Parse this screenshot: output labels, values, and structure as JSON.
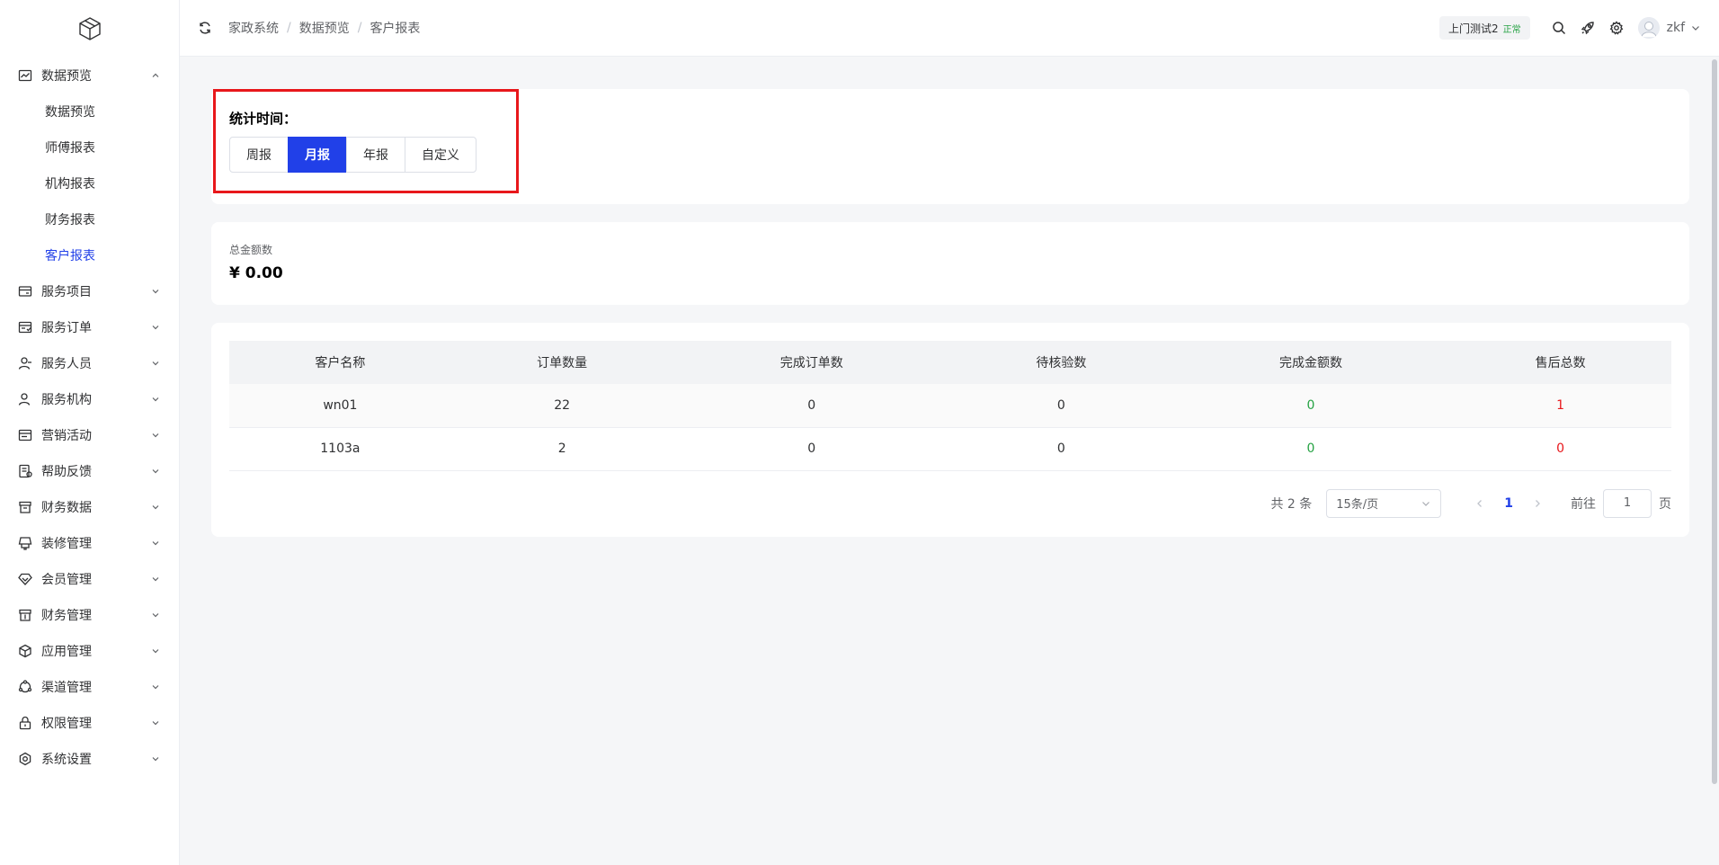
{
  "sidebar": {
    "menu": [
      {
        "label": "数据预览",
        "icon": "chart-line-icon",
        "expanded": true
      },
      {
        "label": "服务项目",
        "icon": "card-icon"
      },
      {
        "label": "服务订单",
        "icon": "order-icon"
      },
      {
        "label": "服务人员",
        "icon": "user-icon"
      },
      {
        "label": "服务机构",
        "icon": "org-user-icon"
      },
      {
        "label": "营销活动",
        "icon": "marketing-icon"
      },
      {
        "label": "帮助反馈",
        "icon": "feedback-icon"
      },
      {
        "label": "财务数据",
        "icon": "finance-data-icon"
      },
      {
        "label": "装修管理",
        "icon": "decoration-icon"
      },
      {
        "label": "会员管理",
        "icon": "member-diamond-icon"
      },
      {
        "label": "财务管理",
        "icon": "finance-manage-icon"
      },
      {
        "label": "应用管理",
        "icon": "app-cube-icon"
      },
      {
        "label": "渠道管理",
        "icon": "channel-icon"
      },
      {
        "label": "权限管理",
        "icon": "lock-icon"
      },
      {
        "label": "系统设置",
        "icon": "settings-icon"
      }
    ],
    "submenu": [
      {
        "label": "数据预览"
      },
      {
        "label": "师傅报表"
      },
      {
        "label": "机构报表"
      },
      {
        "label": "财务报表"
      },
      {
        "label": "客户报表",
        "active": true
      }
    ]
  },
  "header": {
    "breadcrumb": [
      "家政系统",
      "数据预览",
      "客户报表"
    ],
    "store_name": "上门测试2",
    "store_status": "正常",
    "username": "zkf"
  },
  "filter": {
    "title": "统计时间：",
    "options": [
      "周报",
      "月报",
      "年报",
      "自定义"
    ],
    "selected": "月报"
  },
  "summary": {
    "label": "总金额数",
    "value": "¥ 0.00"
  },
  "table": {
    "columns": [
      "客户名称",
      "订单数量",
      "完成订单数",
      "待核验数",
      "完成金额数",
      "售后总数"
    ],
    "rows": [
      [
        "wn01",
        "22",
        "0",
        "0",
        "0",
        "1"
      ],
      [
        "1103a",
        "2",
        "0",
        "0",
        "0",
        "0"
      ]
    ]
  },
  "pagination": {
    "total_text": "共 2 条",
    "page_size": "15条/页",
    "current_page": "1",
    "goto_label": "前往",
    "goto_value": "1",
    "page_suffix": "页"
  },
  "colors": {
    "accent": "#2140e8",
    "success": "#25a243",
    "danger": "#e8171b"
  }
}
